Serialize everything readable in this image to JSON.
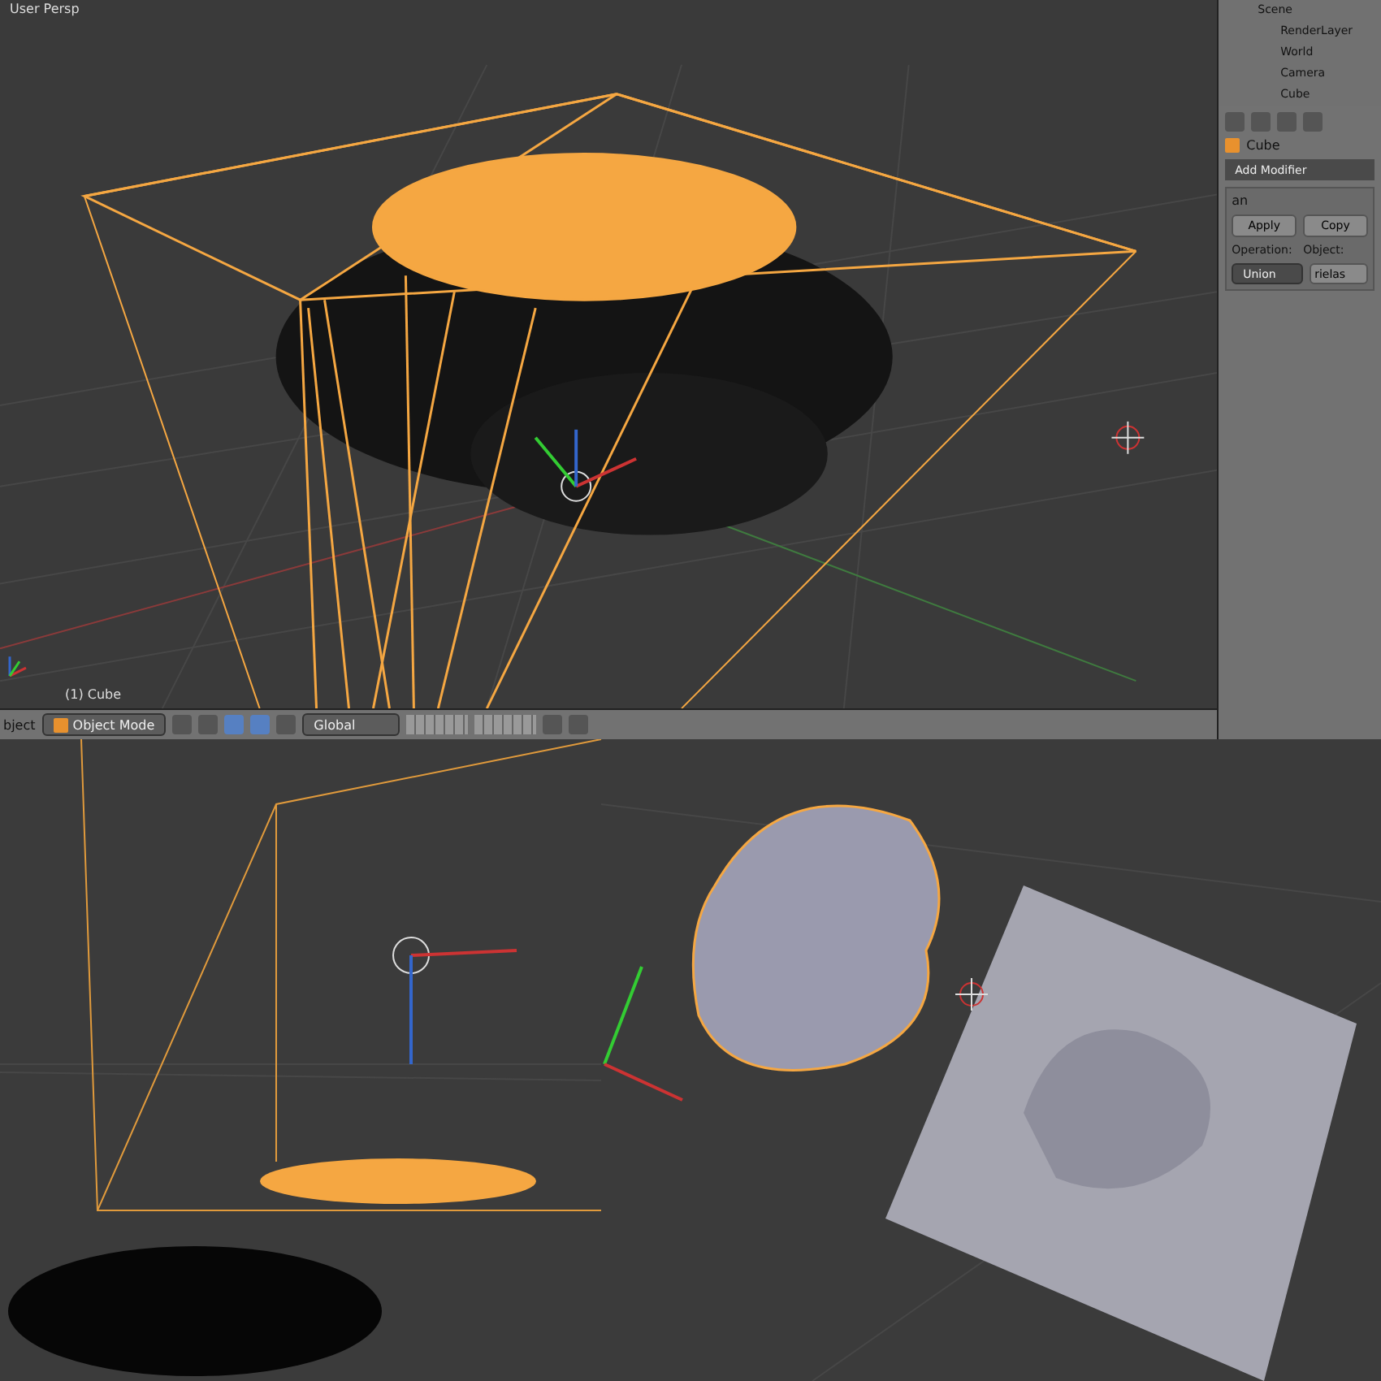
{
  "viewport": {
    "title": "User Persp",
    "object_label": "(1) Cube"
  },
  "header": {
    "menu_partial": "bject",
    "mode": "Object Mode",
    "orientation": "Global"
  },
  "outliner": {
    "items": [
      {
        "label": "Scene",
        "children": [
          {
            "label": "RenderLayer"
          },
          {
            "label": "World"
          },
          {
            "label": "Camera"
          },
          {
            "label": "Cube"
          }
        ]
      }
    ]
  },
  "properties": {
    "object_name": "Cube",
    "add_modifier": "Add Modifier",
    "modifier_name": "an",
    "apply": "Apply",
    "copy": "Copy",
    "operation_label": "Operation:",
    "object_label": "Object:",
    "operation": "Union",
    "object": "rielas"
  }
}
